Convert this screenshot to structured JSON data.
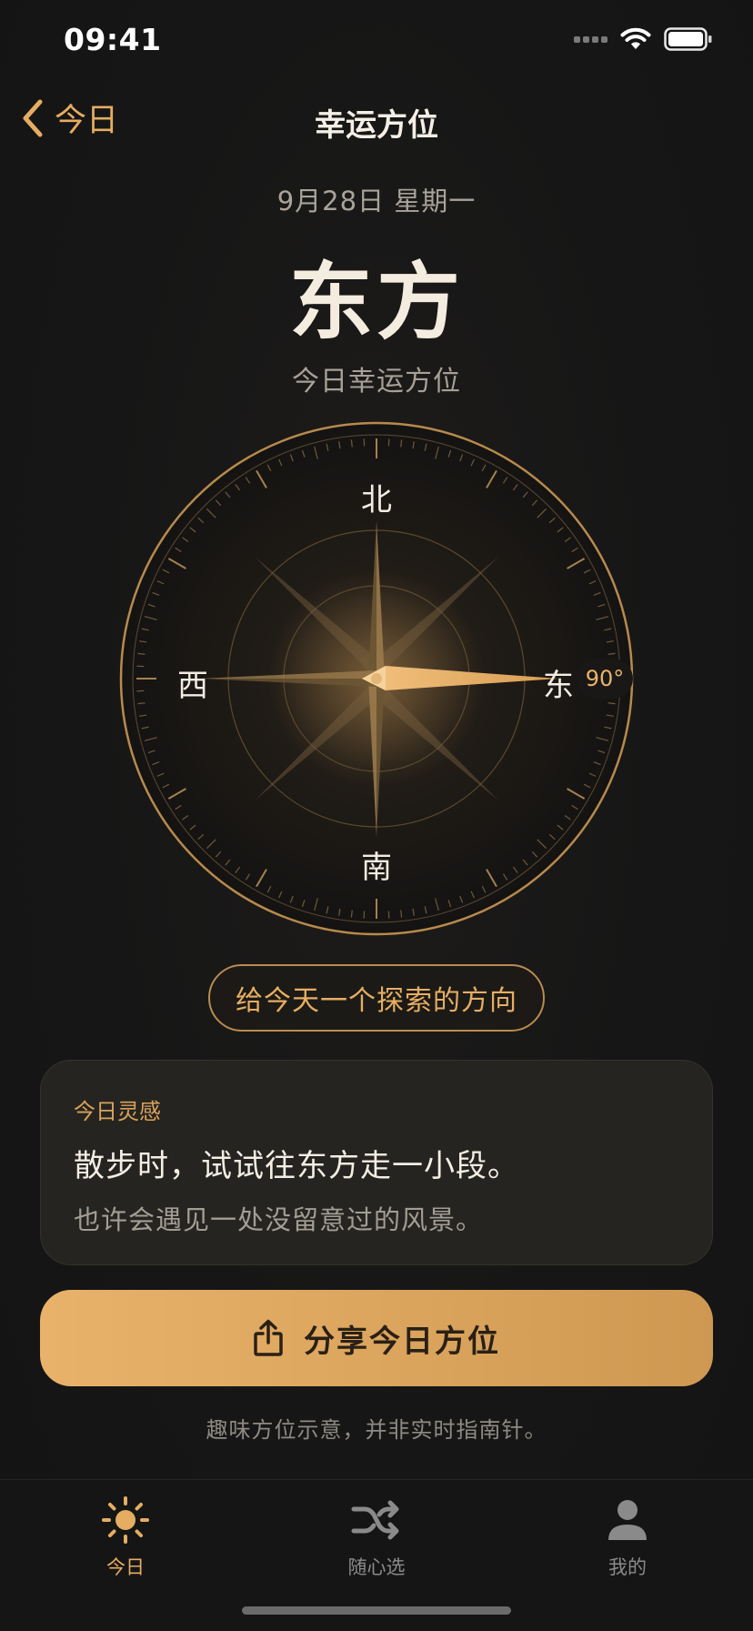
{
  "status_bar": {
    "time": "09:41"
  },
  "nav": {
    "back_label": "今日",
    "title": "幸运方位"
  },
  "hero": {
    "date": "9月28日 星期一",
    "direction": "东方",
    "subtitle": "今日幸运方位"
  },
  "compass": {
    "north": "北",
    "south": "南",
    "west": "西",
    "east": "东",
    "degree": "90°",
    "heading_degrees": 90,
    "accent_color": "#e6ae63"
  },
  "chip": {
    "label": "给今天一个探索的方向"
  },
  "card": {
    "label": "今日灵感",
    "main": "散步时，试试往东方走一小段。",
    "sub": "也许会遇见一处没留意过的风景。"
  },
  "share_button": {
    "label": "分享今日方位"
  },
  "disclaimer": "趣味方位示意，并非实时指南针。",
  "tab_bar": {
    "items": [
      {
        "label": "今日",
        "icon": "sun-icon",
        "active": true
      },
      {
        "label": "随心选",
        "icon": "shuffle-icon",
        "active": false
      },
      {
        "label": "我的",
        "icon": "person-icon",
        "active": false
      }
    ]
  },
  "colors": {
    "accent": "#e5ad62",
    "background": "#161616",
    "card": "#252420"
  }
}
